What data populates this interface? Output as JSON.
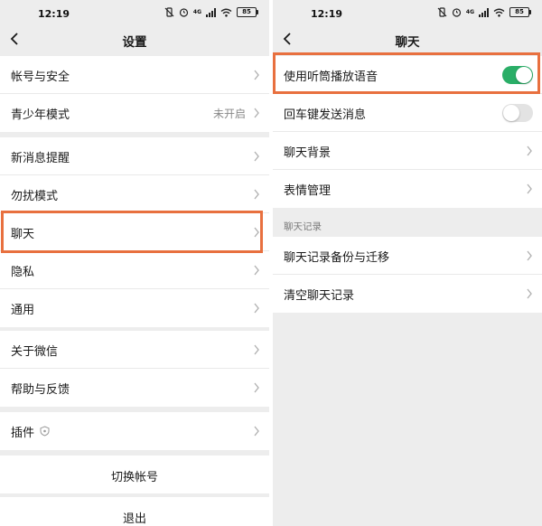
{
  "status_bar": {
    "time": "12:19",
    "battery": "85",
    "network_label": "4G"
  },
  "settings": {
    "title": "设置",
    "groups": [
      [
        {
          "label": "帐号与安全"
        },
        {
          "label": "青少年模式",
          "value": "未开启"
        }
      ],
      [
        {
          "label": "新消息提醒"
        },
        {
          "label": "勿扰模式"
        },
        {
          "label": "聊天"
        },
        {
          "label": "隐私"
        },
        {
          "label": "通用"
        }
      ],
      [
        {
          "label": "关于微信"
        },
        {
          "label": "帮助与反馈"
        }
      ],
      [
        {
          "label": "插件"
        }
      ]
    ],
    "switch_account": "切换帐号",
    "logout": "退出"
  },
  "chat": {
    "title": "聊天",
    "items": [
      {
        "label": "使用听筒播放语音",
        "toggle": true
      },
      {
        "label": "回车键发送消息",
        "toggle": false
      },
      {
        "label": "聊天背景"
      },
      {
        "label": "表情管理"
      }
    ],
    "history_header": "聊天记录",
    "history_items": [
      {
        "label": "聊天记录备份与迁移"
      },
      {
        "label": "清空聊天记录"
      }
    ]
  },
  "colors": {
    "highlight": "#e8703f",
    "toggle_on": "#2aae67",
    "background": "#ededed"
  }
}
